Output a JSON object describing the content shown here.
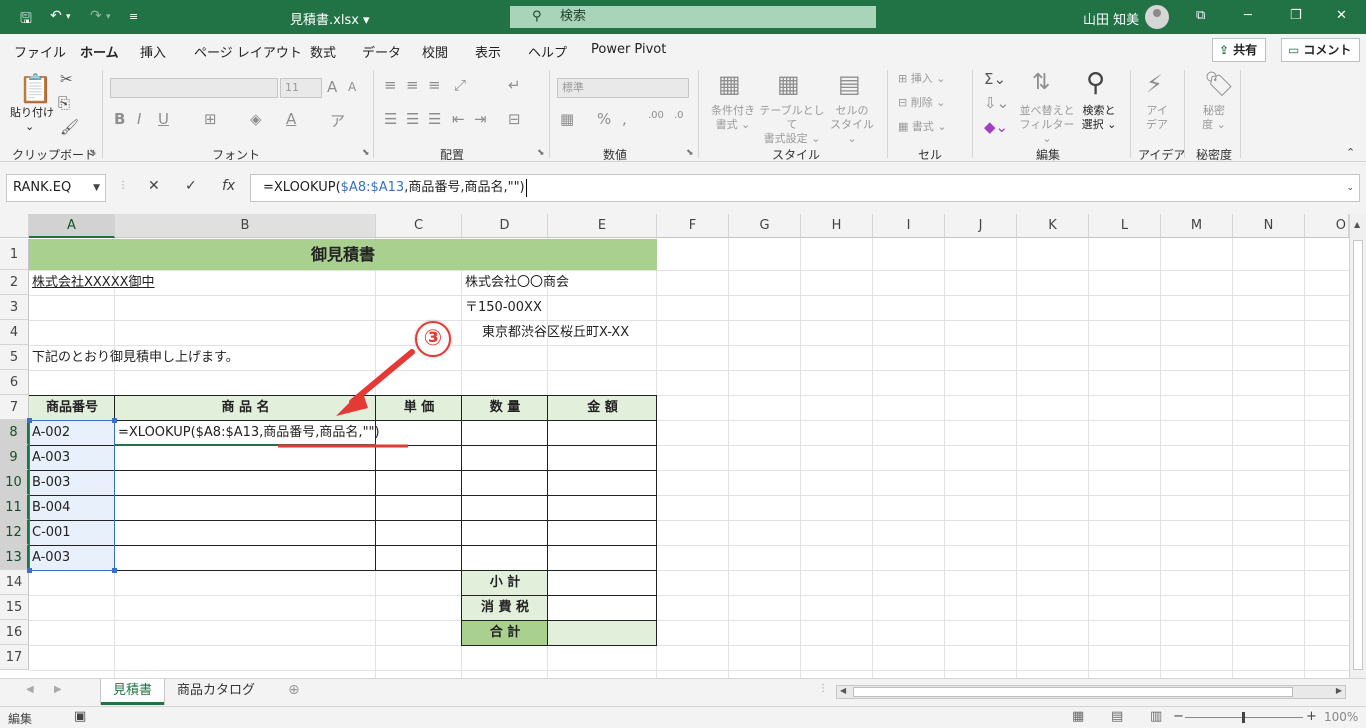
{
  "titlebar": {
    "file_name": "見積書.xlsx",
    "search_placeholder": "検索",
    "user_name": "山田 知美"
  },
  "menu": {
    "tabs": [
      "ファイル",
      "ホーム",
      "挿入",
      "ページ レイアウト",
      "数式",
      "データ",
      "校閲",
      "表示",
      "ヘルプ",
      "Power Pivot"
    ],
    "active_tab": "ホーム",
    "share_label": "共有",
    "comment_label": "コメント"
  },
  "ribbon": {
    "paste_label": "貼り付け",
    "font_size_value": "11",
    "number_format_value": "標準",
    "groups": {
      "clipboard": "クリップボード",
      "font": "フォント",
      "alignment": "配置",
      "number": "数値",
      "styles": "スタイル",
      "cells": "セル",
      "editing": "編集",
      "ideas": "アイデア",
      "sensitivity": "秘密度"
    },
    "styles_buttons": {
      "conditional_1": "条件付き",
      "conditional_2": "書式",
      "table_1": "テーブルとして",
      "table_2": "書式設定",
      "cellstyle_1": "セルの",
      "cellstyle_2": "スタイル"
    },
    "cells_buttons": {
      "insert": "挿入",
      "delete": "削除",
      "format": "書式"
    },
    "editing_buttons": {
      "sort_1": "並べ替えと",
      "sort_2": "フィルター",
      "find_1": "検索と",
      "find_2": "選択"
    },
    "ideas_1": "アイ",
    "ideas_2": "デア",
    "sensitivity_1": "秘密",
    "sensitivity_2": "度"
  },
  "formula_bar": {
    "name_box": "RANK.EQ",
    "formula_prefix": "=XLOOKUP(",
    "formula_ref": "$A8:$A13",
    "formula_suffix": ",商品番号,商品名,\"\")"
  },
  "grid": {
    "columns": [
      "A",
      "B",
      "C",
      "D",
      "E",
      "F",
      "G",
      "H",
      "I",
      "J",
      "K",
      "L",
      "M",
      "N",
      "O"
    ],
    "rows": [
      "1",
      "2",
      "3",
      "4",
      "5",
      "6",
      "7",
      "8",
      "9",
      "10",
      "11",
      "12",
      "13",
      "14",
      "15",
      "16",
      "17"
    ],
    "title": "御見積書",
    "customer": "株式会社XXXXX御中",
    "company": "株式会社〇〇商会",
    "postal": "〒150-00XX",
    "address": "東京都渋谷区桜丘町X-XX",
    "intro": "下記のとおり御見積申し上げます。",
    "table_headers": [
      "商品番号",
      "商 品 名",
      "単 価",
      "数 量",
      "金 額"
    ],
    "product_codes": [
      "A-002",
      "A-003",
      "B-003",
      "B-004",
      "C-001",
      "A-003"
    ],
    "edit_formula": "=XLOOKUP($A8:$A13,商品番号,商品名,\"\")",
    "subtotal_label": "小 計",
    "tax_label": "消 費 税",
    "total_label": "合 計"
  },
  "sheets": {
    "tabs": [
      "見積書",
      "商品カタログ"
    ],
    "active": "見積書"
  },
  "status": {
    "mode": "編集",
    "zoom": "100%"
  },
  "annotation": {
    "step_marker": "③"
  },
  "colors": {
    "excel_green": "#217346",
    "header_fill": "#e2efda",
    "title_fill": "#a9d08e",
    "annotation_red": "#e53935",
    "ref_blue": "#3a6fc4"
  }
}
